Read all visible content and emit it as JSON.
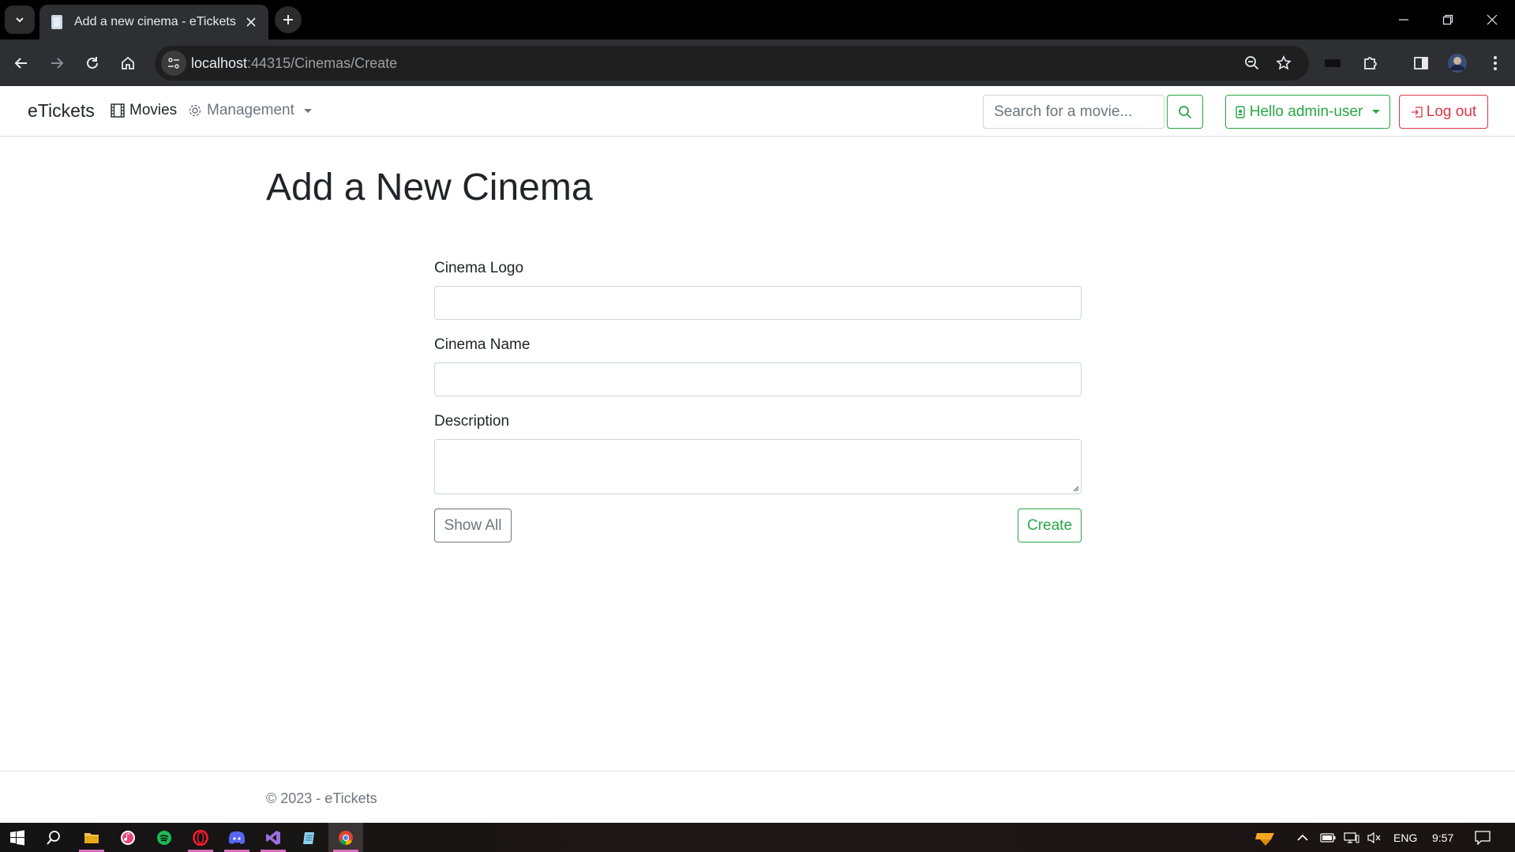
{
  "browser": {
    "tab_title": "Add a new cinema - eTickets",
    "url_host": "localhost",
    "url_path": ":44315/Cinemas/Create"
  },
  "navbar": {
    "brand": "eTickets",
    "movies": "Movies",
    "management": "Management",
    "search_placeholder": "Search for a movie...",
    "user_label": "Hello admin-user",
    "logout_label": "Log out"
  },
  "page": {
    "title": "Add a New Cinema"
  },
  "form": {
    "logo_label": "Cinema Logo",
    "logo_value": "",
    "name_label": "Cinema Name",
    "name_value": "",
    "description_label": "Description",
    "description_value": "",
    "show_all_label": "Show All",
    "create_label": "Create"
  },
  "footer": {
    "text": "© 2023 - eTickets"
  },
  "taskbar": {
    "lang": "ENG",
    "time": "9:57"
  },
  "colors": {
    "success": "#28a745",
    "danger": "#dc3545",
    "secondary": "#6c757d"
  }
}
